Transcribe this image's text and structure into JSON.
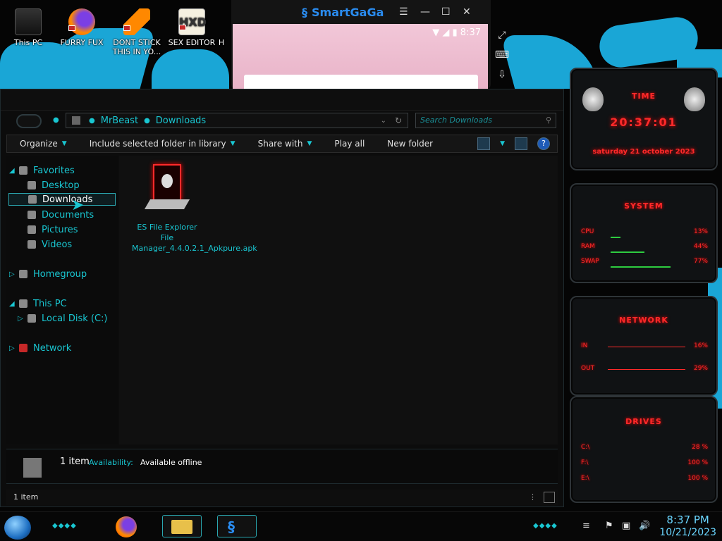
{
  "desktop": {
    "icons": [
      {
        "label": "This PC"
      },
      {
        "label": "FURRY FUX"
      },
      {
        "label": "DONT STICK THIS IN YO..."
      },
      {
        "label": "SEX EDITOR"
      },
      {
        "label": "H"
      }
    ]
  },
  "smartgaga": {
    "title": "SmartGaGa",
    "time": "8:37"
  },
  "explorer": {
    "breadcrumb": [
      "MrBeast",
      "Downloads"
    ],
    "search_placeholder": "Search Downloads",
    "toolbar": {
      "organize": "Organize",
      "include": "Include selected folder in library",
      "share": "Share with",
      "play": "Play all",
      "new_folder": "New folder",
      "help": "?"
    },
    "nav": {
      "favorites": "Favorites",
      "desktop": "Desktop",
      "downloads": "Downloads",
      "documents": "Documents",
      "pictures": "Pictures",
      "videos": "Videos",
      "homegroup": "Homegroup",
      "this_pc": "This PC",
      "local_disk": "Local Disk (C:)",
      "network": "Network"
    },
    "file": {
      "name": "ES File Explorer File Manager_4.4.0.2.1_Apkpure.apk"
    },
    "details": {
      "count": "1 item",
      "availability_label": "Availability:",
      "availability_value": "Available offline"
    },
    "status": "1 item"
  },
  "gadgets": {
    "time": {
      "title": "TIME",
      "clock": "20:37:01",
      "date": "saturday 21 october 2023"
    },
    "system": {
      "title": "SYSTEM",
      "rows": [
        {
          "label": "CPU",
          "value": "13%",
          "level": 0.13
        },
        {
          "label": "RAM",
          "value": "44%",
          "level": 0.44
        },
        {
          "label": "SWAP",
          "value": "77%",
          "level": 0.77
        }
      ]
    },
    "network": {
      "title": "NETWORK",
      "rows": [
        {
          "label": "IN",
          "value": "16%"
        },
        {
          "label": "OUT",
          "value": "29%"
        }
      ]
    },
    "drives": {
      "title": "DRIVES",
      "rows": [
        {
          "label": "C:\\",
          "value": "28 %"
        },
        {
          "label": "F:\\",
          "value": "100 %"
        },
        {
          "label": "E:\\",
          "value": "100 %"
        }
      ]
    }
  },
  "taskbar": {
    "time": "8:37 PM",
    "date": "10/21/2023"
  },
  "colors": {
    "accent": "#19c6d1",
    "gadget_red": "#ff2a2a",
    "meter_green": "#2ecc40"
  }
}
